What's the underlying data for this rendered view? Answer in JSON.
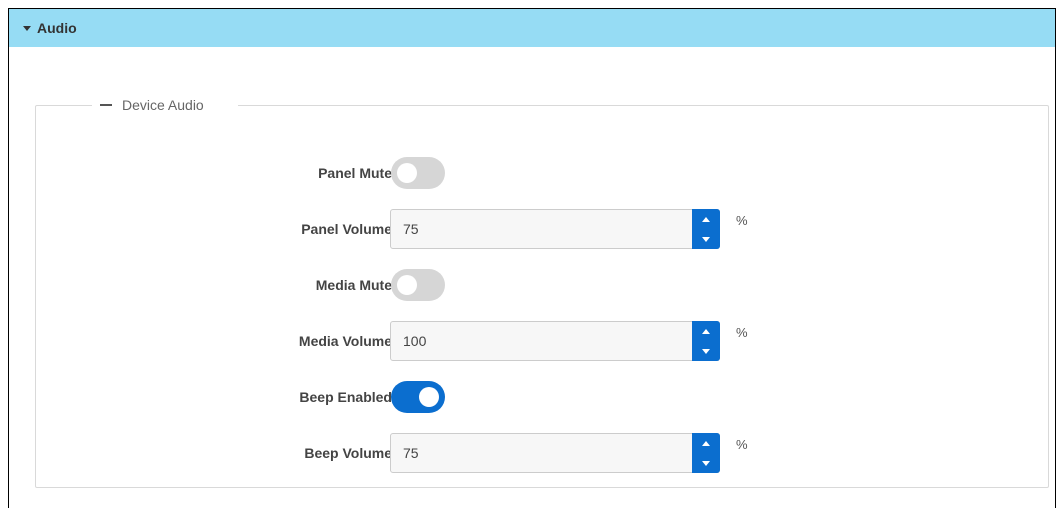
{
  "section": {
    "title": "Audio"
  },
  "group": {
    "title": "Device Audio"
  },
  "colors": {
    "header_bg": "#96dcf4",
    "accent": "#0b6ecf",
    "toggle_off": "#d6d6d6"
  },
  "icons": {
    "section_toggle": "caret-down-icon",
    "group_toggle": "minus-icon",
    "increment": "caret-up-icon",
    "decrement": "caret-down-icon"
  },
  "fields": {
    "panel_mute": {
      "label": "Panel Mute",
      "state": "off"
    },
    "panel_volume": {
      "label": "Panel Volume",
      "value": "75",
      "unit": "%"
    },
    "media_mute": {
      "label": "Media Mute",
      "state": "off"
    },
    "media_volume": {
      "label": "Media Volume",
      "value": "100",
      "unit": "%"
    },
    "beep_enabled": {
      "label": "Beep Enabled",
      "state": "on"
    },
    "beep_volume": {
      "label": "Beep Volume",
      "value": "75",
      "unit": "%"
    }
  }
}
